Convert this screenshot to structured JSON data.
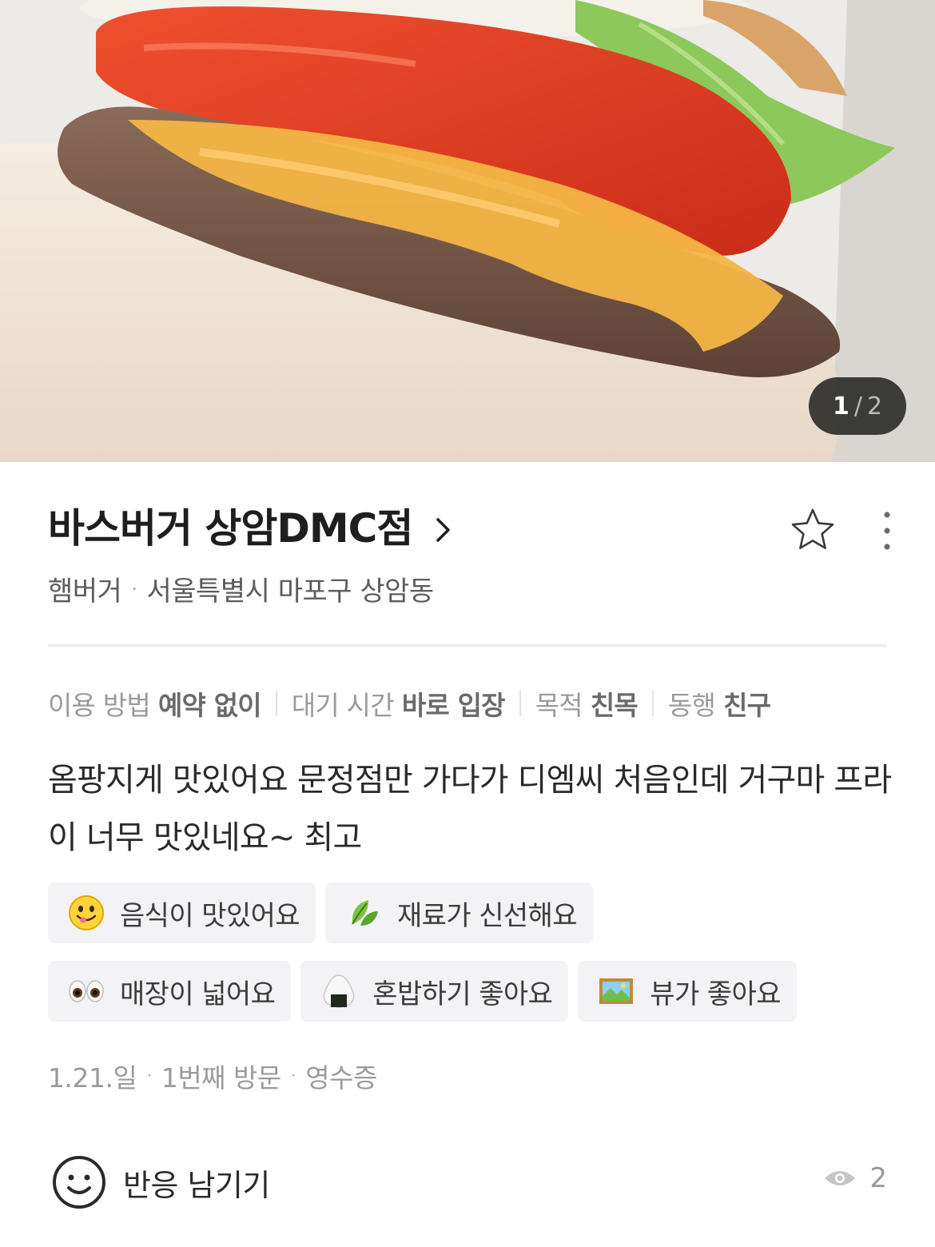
{
  "photo": {
    "alt": "",
    "counter_current": "1",
    "counter_separator": "/",
    "counter_total": "2"
  },
  "place": {
    "name": "바스버거 상암DMC점",
    "category": "햄버거",
    "address": "서울특별시 마포구 상암동"
  },
  "info": [
    {
      "label": "이용 방법",
      "value": "예약 없이"
    },
    {
      "label": "대기 시간",
      "value": "바로 입장"
    },
    {
      "label": "목적",
      "value": "친목"
    },
    {
      "label": "동행",
      "value": "친구"
    }
  ],
  "review": {
    "text": "옴팡지게 맛있어요 문정점만 가다가 디엠씨 처음인데 거구마 프라이 너무 맛있네요~ 최고"
  },
  "keywords": [
    {
      "icon": "yum-face-icon",
      "label": "음식이 맛있어요"
    },
    {
      "icon": "leaf-icon",
      "label": "재료가 신선해요"
    },
    {
      "icon": "eyes-icon",
      "label": "매장이 넓어요"
    },
    {
      "icon": "rice-ball-icon",
      "label": "혼밥하기 좋아요"
    },
    {
      "icon": "landscape-picture-icon",
      "label": "뷰가 좋아요"
    }
  ],
  "meta": {
    "date": "1.21.일",
    "visit": "1번째 방문",
    "verification": "영수증"
  },
  "actions": {
    "react_label": "반응 남기기",
    "view_count": "2"
  },
  "colors": {
    "text_primary": "#1e1e1e",
    "text_secondary": "#5c5c5c",
    "text_muted": "#9a9a9a",
    "chip_bg": "#f3f3f5",
    "divider": "#ededed"
  }
}
